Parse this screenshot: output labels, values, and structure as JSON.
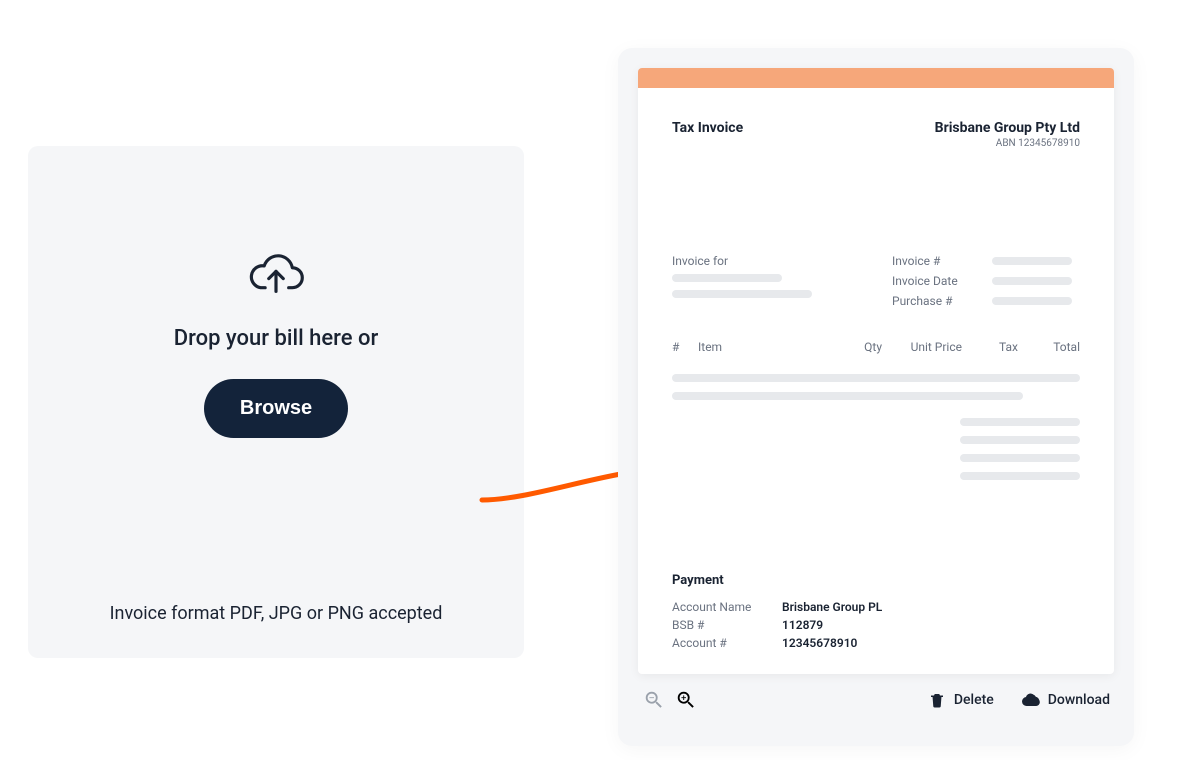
{
  "upload": {
    "drop_text": "Drop your bill here or",
    "browse_label": "Browse",
    "hint": "Invoice format PDF, JPG or PNG accepted"
  },
  "invoice": {
    "accent_color": "#f6a77a",
    "title": "Tax Invoice",
    "company_name": "Brisbane Group Pty Ltd",
    "abn": "ABN 12345678910",
    "invoice_for_label": "Invoice for",
    "meta_labels": {
      "invoice_no": "Invoice #",
      "invoice_date": "Invoice Date",
      "purchase_no": "Purchase #"
    },
    "columns": {
      "num": "#",
      "item": "Item",
      "qty": "Qty",
      "unit_price": "Unit Price",
      "tax": "Tax",
      "total": "Total"
    },
    "payment": {
      "title": "Payment",
      "account_name_label": "Account Name",
      "account_name": "Brisbane Group PL",
      "bsb_label": "BSB #",
      "bsb": "112879",
      "account_no_label": "Account #",
      "account_no": "12345678910"
    }
  },
  "toolbar": {
    "delete_label": "Delete",
    "download_label": "Download"
  }
}
